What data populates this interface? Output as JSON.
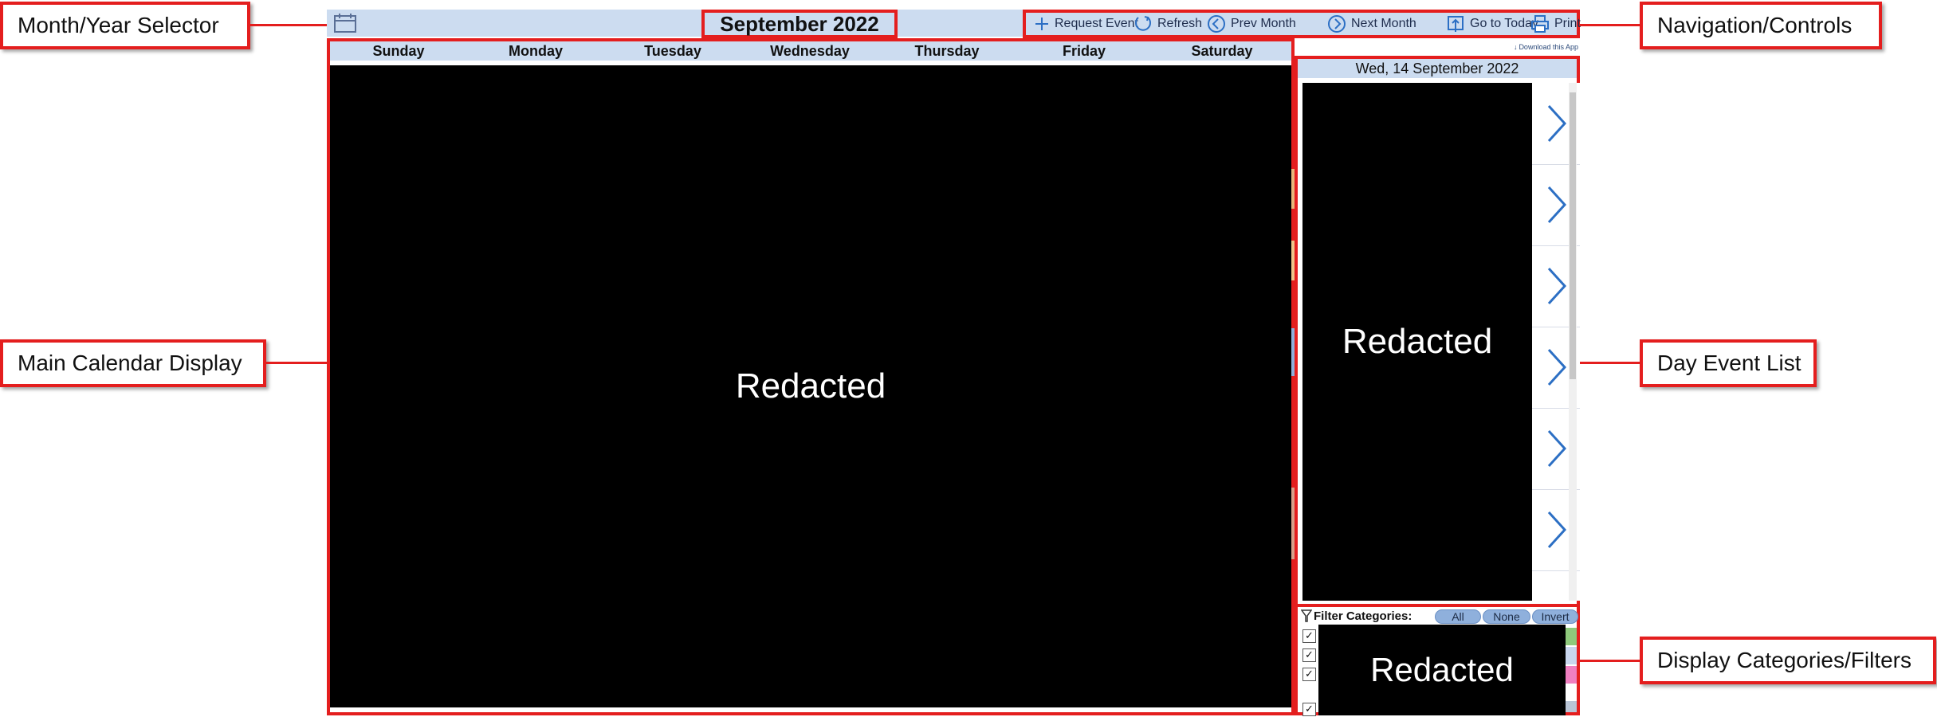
{
  "callouts": {
    "month_year_selector": "Month/Year Selector",
    "navigation_controls": "Navigation/Controls",
    "main_calendar_display": "Main Calendar Display",
    "day_event_list": "Day Event List",
    "display_categories_filters": "Display Categories/Filters"
  },
  "header": {
    "month_title": "September 2022",
    "actions": {
      "request_event": "Request Event",
      "refresh": "Refresh",
      "prev_month": "Prev Month",
      "next_month": "Next Month",
      "go_to_today": "Go to Today",
      "print": "Print"
    }
  },
  "calendar": {
    "weekdays": [
      "Sunday",
      "Monday",
      "Tuesday",
      "Wednesday",
      "Thursday",
      "Friday",
      "Saturday"
    ],
    "redacted_label": "Redacted"
  },
  "day_panel": {
    "download_link": "Download this App",
    "selected_date": "Wed, 14 September 2022",
    "redacted_label": "Redacted"
  },
  "filters": {
    "label": "Filter Categories:",
    "all": "All",
    "none": "None",
    "invert": "Invert",
    "redacted_label": "Redacted",
    "swatch_colors": [
      "#8fc97c",
      "#c9d6ee",
      "#f07fc0",
      "#ffffff",
      "#b9c5d6"
    ]
  },
  "colors": {
    "accent_red": "#e41e1e",
    "header_bar": "#ccdcf0",
    "chevron_blue": "#2c6fc4"
  }
}
